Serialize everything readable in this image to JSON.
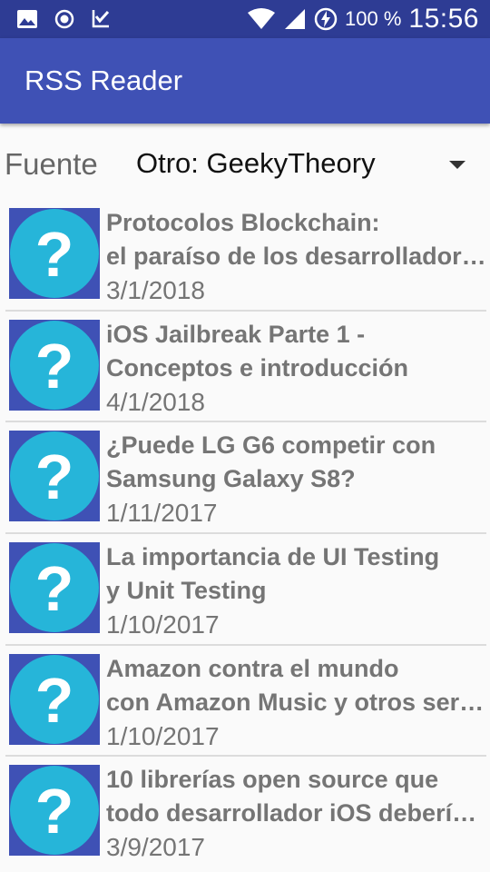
{
  "status_bar": {
    "icons": [
      "image-icon",
      "record-icon",
      "download-check-icon",
      "wifi-icon",
      "signal-icon",
      "battery-charging-icon"
    ],
    "battery": "100 %",
    "time": "15:56"
  },
  "app_bar": {
    "title": "RSS Reader"
  },
  "source": {
    "label": "Fuente",
    "selected": "Otro: GeekyTheory"
  },
  "items": [
    {
      "title": [
        "Protocolos Blockchain:",
        "el paraíso de los desarrolladores"
      ],
      "date": "3/1/2018"
    },
    {
      "title": [
        "iOS Jailbreak Parte 1 -",
        "Conceptos e introducción"
      ],
      "date": "4/1/2018"
    },
    {
      "title": [
        "¿Puede LG G6 competir con",
        "Samsung Galaxy S8?"
      ],
      "date": "1/11/2017"
    },
    {
      "title": [
        "La importancia de UI Testing",
        "y Unit Testing"
      ],
      "date": "1/10/2017"
    },
    {
      "title": [
        "Amazon contra el mundo",
        "con Amazon Music y otros servicios"
      ],
      "date": "1/10/2017"
    },
    {
      "title": [
        "10 librerías open source que",
        "todo desarrollador iOS debería conocer"
      ],
      "date": "3/9/2017"
    }
  ],
  "colors": {
    "status_bar": "#2e3c94",
    "app_bar": "#3f51b5",
    "thumb_circle": "#26b5d9",
    "text_gray": "#757575"
  }
}
